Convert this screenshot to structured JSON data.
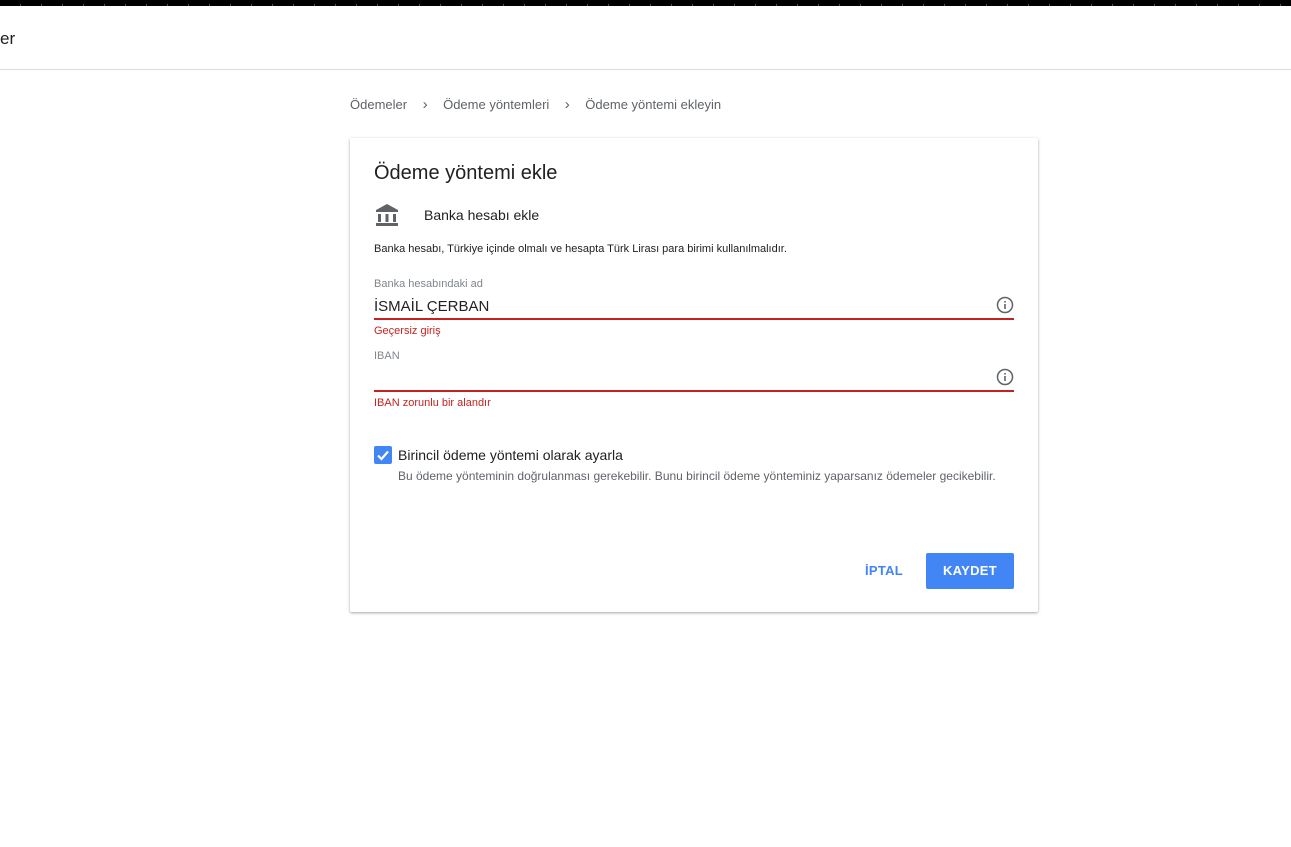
{
  "header": {
    "title": "er"
  },
  "breadcrumb": {
    "items": [
      "Ödemeler",
      "Ödeme yöntemleri",
      "Ödeme yöntemi ekleyin"
    ]
  },
  "card": {
    "title": "Ödeme yöntemi ekle",
    "method_label": "Banka hesabı ekle",
    "method_icon": "bank-icon",
    "info": "Banka hesabı, Türkiye içinde olmalı ve hesapta Türk Lirası para birimi kullanılmalıdır."
  },
  "fields": {
    "name": {
      "label": "Banka hesabındaki ad",
      "value": "İSMAİL ÇERBAN",
      "error": "Geçersiz giriş"
    },
    "iban": {
      "label": "IBAN",
      "value": "",
      "error": "IBAN zorunlu bir alandır"
    }
  },
  "primary": {
    "checked": true,
    "label": "Birincil ödeme yöntemi olarak ayarla",
    "description": "Bu ödeme yönteminin doğrulanması gerekebilir. Bunu birincil ödeme yönteminiz yaparsanız ödemeler gecikebilir."
  },
  "actions": {
    "cancel_label": "İPTAL",
    "save_label": "KAYDET"
  },
  "colors": {
    "accent": "#4285f4",
    "error": "#c5221f"
  }
}
